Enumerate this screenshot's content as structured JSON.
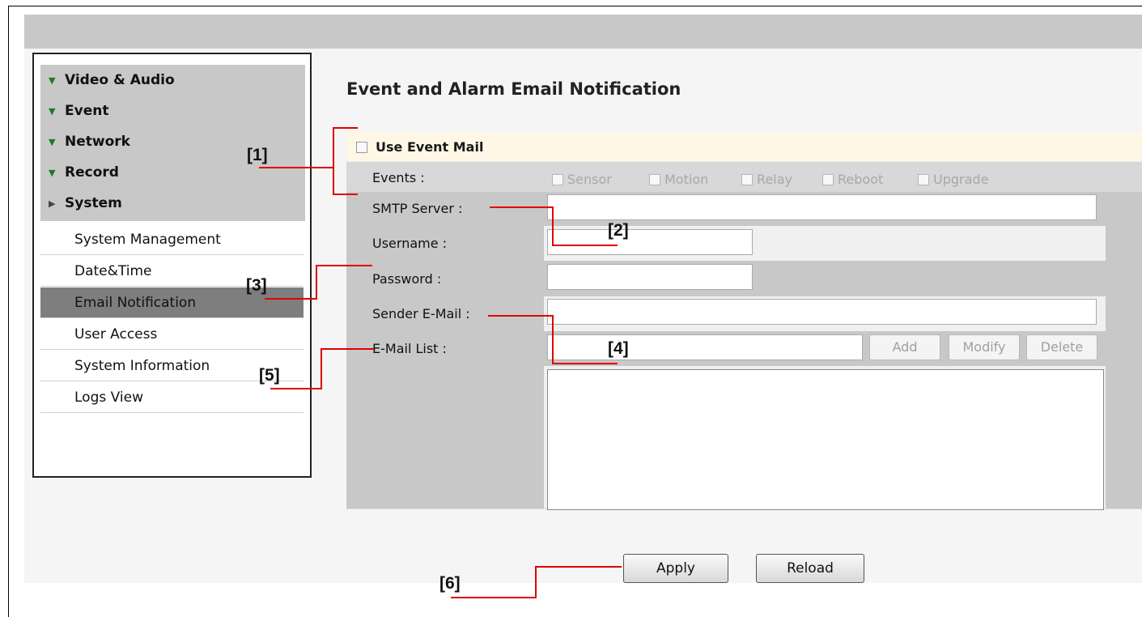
{
  "sidebar": {
    "groups": [
      {
        "label": "Video & Audio",
        "icon": "triangle-down-icon"
      },
      {
        "label": "Event",
        "icon": "triangle-down-icon"
      },
      {
        "label": "Network",
        "icon": "triangle-down-icon"
      },
      {
        "label": "Record",
        "icon": "triangle-down-icon"
      },
      {
        "label": "System",
        "icon": "triangle-right-icon"
      }
    ],
    "system_items": [
      "System Management",
      "Date&Time",
      "Email Notification",
      "User Access",
      "System Information",
      "Logs View"
    ],
    "active_item": "Email Notification"
  },
  "main": {
    "title": "Event and Alarm Email Notification",
    "use_event_mail_label": "Use Event Mail",
    "events_label": "Events :",
    "events": [
      "Sensor",
      "Motion",
      "Relay",
      "Reboot",
      "Upgrade"
    ],
    "smtp_label": "SMTP Server :",
    "username_label": "Username :",
    "password_label": "Password :",
    "sender_label": "Sender E-Mail :",
    "email_list_label": "E-Mail List :",
    "add_label": "Add",
    "modify_label": "Modify",
    "delete_label": "Delete",
    "apply_label": "Apply",
    "reload_label": "Reload"
  },
  "callouts": [
    "[1]",
    "[2]",
    "[3]",
    "[4]",
    "[5]",
    "[6]"
  ],
  "colors": {
    "callout_line": "#e00000",
    "header_row": "#fff7e6",
    "label_bg": "#c8c8c8",
    "active_item": "#7e7e7e",
    "group_arrow": "#1f7a1f"
  }
}
